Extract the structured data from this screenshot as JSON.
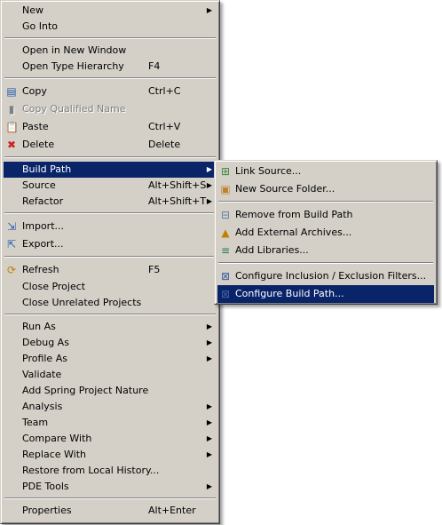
{
  "colors": {
    "menu_bg": "#d4d0c8",
    "highlight": "#0a246a"
  },
  "main_menu": [
    {
      "label": "New",
      "submenu": true
    },
    {
      "label": "Go Into"
    },
    {
      "sep": true
    },
    {
      "label": "Open in New Window"
    },
    {
      "label": "Open Type Hierarchy",
      "shortcut": "F4"
    },
    {
      "sep": true
    },
    {
      "label": "Copy",
      "shortcut": "Ctrl+C",
      "icon": "copy-icon"
    },
    {
      "label": "Copy Qualified Name",
      "icon": "copy-qualified-name-icon",
      "disabled": true
    },
    {
      "label": "Paste",
      "shortcut": "Ctrl+V",
      "icon": "paste-icon"
    },
    {
      "label": "Delete",
      "shortcut": "Delete",
      "icon": "delete-icon"
    },
    {
      "sep": true
    },
    {
      "label": "Build Path",
      "submenu": true,
      "highlighted": true
    },
    {
      "label": "Source",
      "shortcut": "Alt+Shift+S",
      "submenu": true
    },
    {
      "label": "Refactor",
      "shortcut": "Alt+Shift+T",
      "submenu": true
    },
    {
      "sep": true
    },
    {
      "label": "Import...",
      "icon": "import-icon"
    },
    {
      "label": "Export...",
      "icon": "export-icon"
    },
    {
      "sep": true
    },
    {
      "label": "Refresh",
      "shortcut": "F5",
      "icon": "refresh-icon"
    },
    {
      "label": "Close Project"
    },
    {
      "label": "Close Unrelated Projects"
    },
    {
      "sep": true
    },
    {
      "label": "Run As",
      "submenu": true
    },
    {
      "label": "Debug As",
      "submenu": true
    },
    {
      "label": "Profile As",
      "submenu": true
    },
    {
      "label": "Validate"
    },
    {
      "label": "Add Spring Project Nature"
    },
    {
      "label": "Analysis",
      "submenu": true
    },
    {
      "label": "Team",
      "submenu": true
    },
    {
      "label": "Compare With",
      "submenu": true
    },
    {
      "label": "Replace With",
      "submenu": true
    },
    {
      "label": "Restore from Local History..."
    },
    {
      "label": "PDE Tools",
      "submenu": true
    },
    {
      "sep": true
    },
    {
      "label": "Properties",
      "shortcut": "Alt+Enter"
    }
  ],
  "build_path_submenu": [
    {
      "label": "Link Source...",
      "icon": "link-source-icon"
    },
    {
      "label": "New Source Folder...",
      "icon": "new-source-folder-icon"
    },
    {
      "sep": true
    },
    {
      "label": "Remove from Build Path",
      "icon": "remove-from-build-path-icon"
    },
    {
      "label": "Add External Archives...",
      "icon": "add-external-archives-icon"
    },
    {
      "label": "Add Libraries...",
      "icon": "add-libraries-icon"
    },
    {
      "sep": true
    },
    {
      "label": "Configure Inclusion / Exclusion Filters...",
      "icon": "configure-filters-icon"
    },
    {
      "label": "Configure Build Path...",
      "icon": "configure-build-path-icon",
      "highlighted": true
    }
  ]
}
